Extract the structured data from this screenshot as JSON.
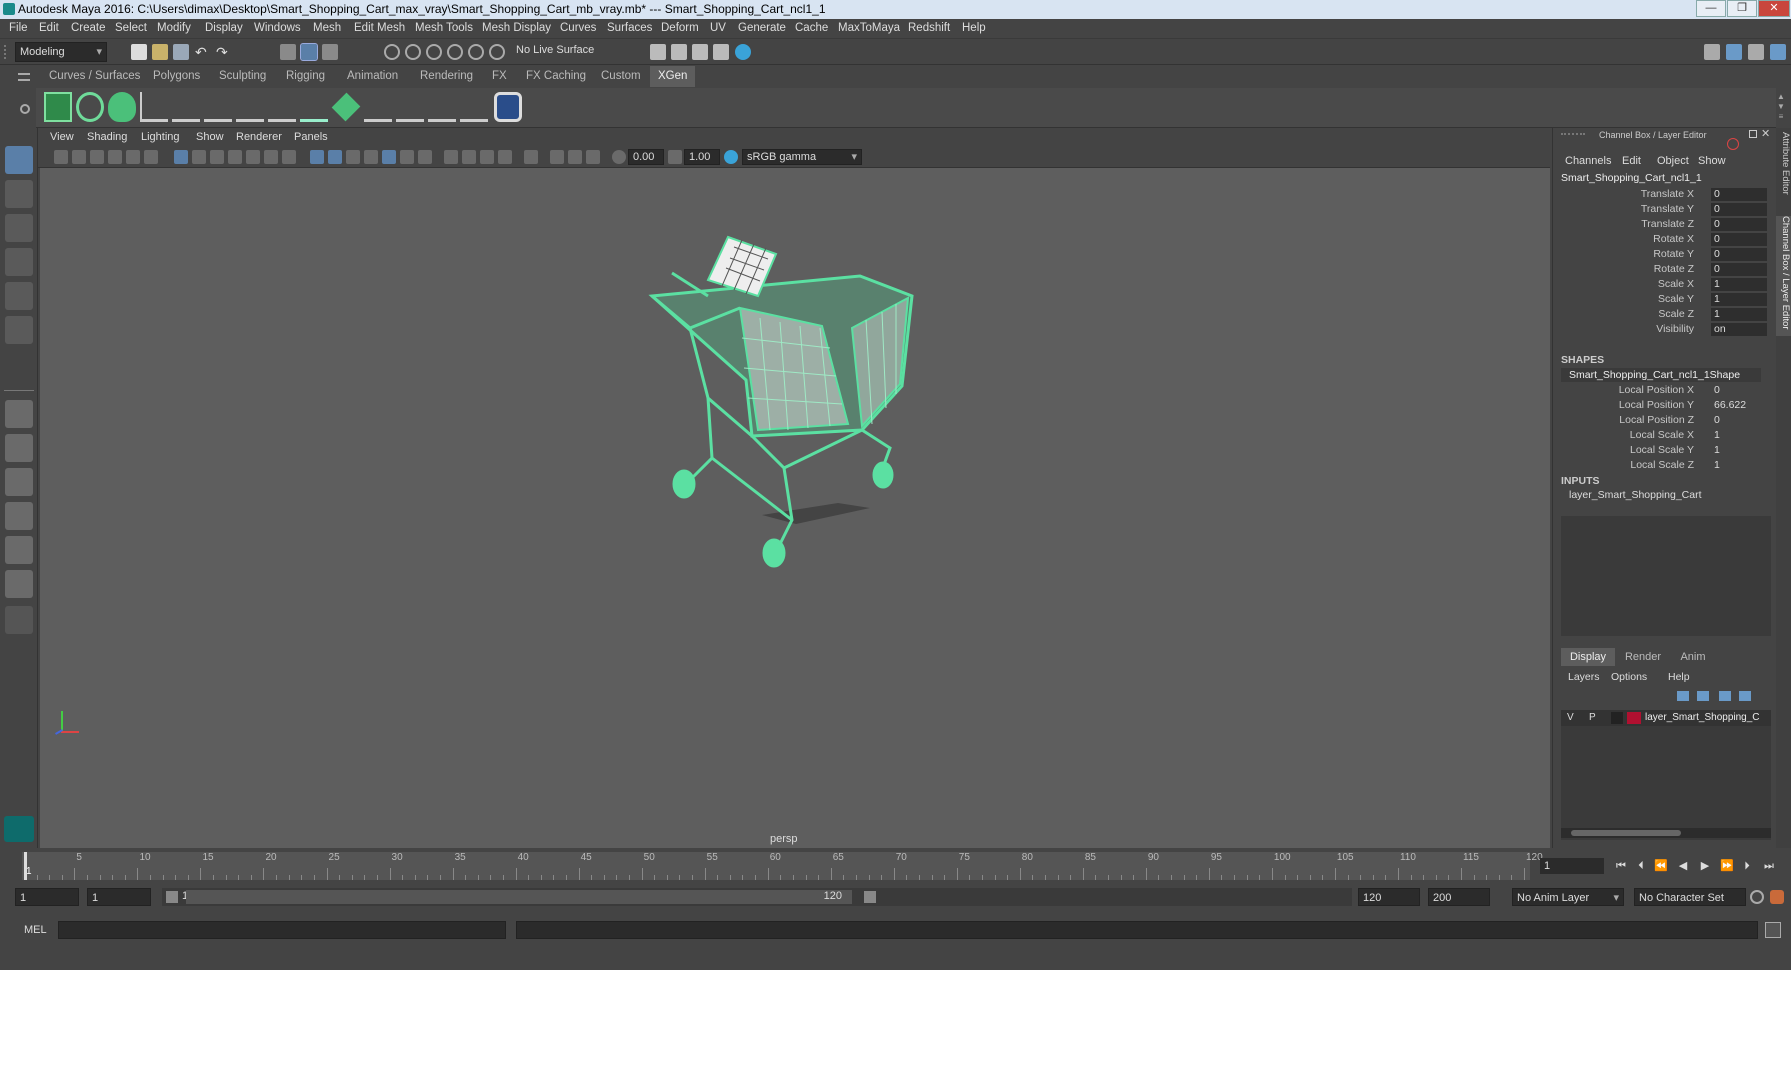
{
  "title": "Autodesk Maya 2016: C:\\Users\\dimax\\Desktop\\Smart_Shopping_Cart_max_vray\\Smart_Shopping_Cart_mb_vray.mb*   ---   Smart_Shopping_Cart_ncl1_1",
  "window_buttons": [
    "—",
    "❐",
    "✕"
  ],
  "menu": [
    "File",
    "Edit",
    "Create",
    "Select",
    "Modify",
    "Display",
    "Windows",
    "Mesh",
    "Edit Mesh",
    "Mesh Tools",
    "Mesh Display",
    "Curves",
    "Surfaces",
    "Deform",
    "UV",
    "Generate",
    "Cache",
    "MaxToMaya",
    "Redshift",
    "Help"
  ],
  "status_line": {
    "mode": "Modeling",
    "live_surface": "No Live Surface"
  },
  "shelf_tabs": [
    {
      "label": "Curves / Surfaces",
      "active": false
    },
    {
      "label": "Polygons",
      "active": false
    },
    {
      "label": "Sculpting",
      "active": false
    },
    {
      "label": "Rigging",
      "active": false
    },
    {
      "label": "Animation",
      "active": false
    },
    {
      "label": "Rendering",
      "active": false
    },
    {
      "label": "FX",
      "active": false
    },
    {
      "label": "FX Caching",
      "active": false
    },
    {
      "label": "Custom",
      "active": false
    },
    {
      "label": "XGen",
      "active": true
    }
  ],
  "panel_menu": [
    "View",
    "Shading",
    "Lighting",
    "Show",
    "Renderer",
    "Panels"
  ],
  "panel_toolbar": {
    "exposure": "0.00",
    "gamma": "1.00",
    "color_space": "sRGB gamma"
  },
  "viewport": {
    "camera_label": "persp",
    "wire_color": "#5be0a2"
  },
  "channel_box": {
    "header": "Channel Box / Layer Editor",
    "menu": [
      "Channels",
      "Edit",
      "Object",
      "Show"
    ],
    "object": "Smart_Shopping_Cart_ncl1_1",
    "attrs": [
      {
        "name": "Translate X",
        "value": "0"
      },
      {
        "name": "Translate Y",
        "value": "0"
      },
      {
        "name": "Translate Z",
        "value": "0"
      },
      {
        "name": "Rotate X",
        "value": "0"
      },
      {
        "name": "Rotate Y",
        "value": "0"
      },
      {
        "name": "Rotate Z",
        "value": "0"
      },
      {
        "name": "Scale X",
        "value": "1"
      },
      {
        "name": "Scale Y",
        "value": "1"
      },
      {
        "name": "Scale Z",
        "value": "1"
      },
      {
        "name": "Visibility",
        "value": "on"
      }
    ],
    "shapes_title": "SHAPES",
    "shape_name": "Smart_Shopping_Cart_ncl1_1Shape",
    "shape_attrs": [
      {
        "name": "Local Position X",
        "value": "0"
      },
      {
        "name": "Local Position Y",
        "value": "66.622"
      },
      {
        "name": "Local Position Z",
        "value": "0"
      },
      {
        "name": "Local Scale X",
        "value": "1"
      },
      {
        "name": "Local Scale Y",
        "value": "1"
      },
      {
        "name": "Local Scale Z",
        "value": "1"
      }
    ],
    "inputs_title": "INPUTS",
    "input_name": "layer_Smart_Shopping_Cart"
  },
  "layer_editor": {
    "tabs": [
      {
        "label": "Display",
        "active": true
      },
      {
        "label": "Render",
        "active": false
      },
      {
        "label": "Anim",
        "active": false
      }
    ],
    "menu": [
      "Layers",
      "Options",
      "Help"
    ],
    "layer": {
      "v": "V",
      "p": "P",
      "color": "#b01030",
      "name": "layer_Smart_Shopping_C"
    }
  },
  "side_tabs": [
    "Attribute Editor",
    "Channel Box / Layer Editor"
  ],
  "timeline": {
    "ticks": [
      "1",
      "5",
      "10",
      "15",
      "20",
      "25",
      "30",
      "35",
      "40",
      "45",
      "50",
      "55",
      "60",
      "65",
      "70",
      "75",
      "80",
      "85",
      "90",
      "95",
      "100",
      "105",
      "110",
      "115",
      "120"
    ],
    "current_frame": "1"
  },
  "range": {
    "start": "1",
    "playback_start": "1",
    "slider_start": "1",
    "slider_end": "120",
    "playback_end": "120",
    "end": "200",
    "anim_layer": "No Anim Layer",
    "char_set": "No Character Set"
  },
  "command_line": {
    "label": "MEL"
  }
}
